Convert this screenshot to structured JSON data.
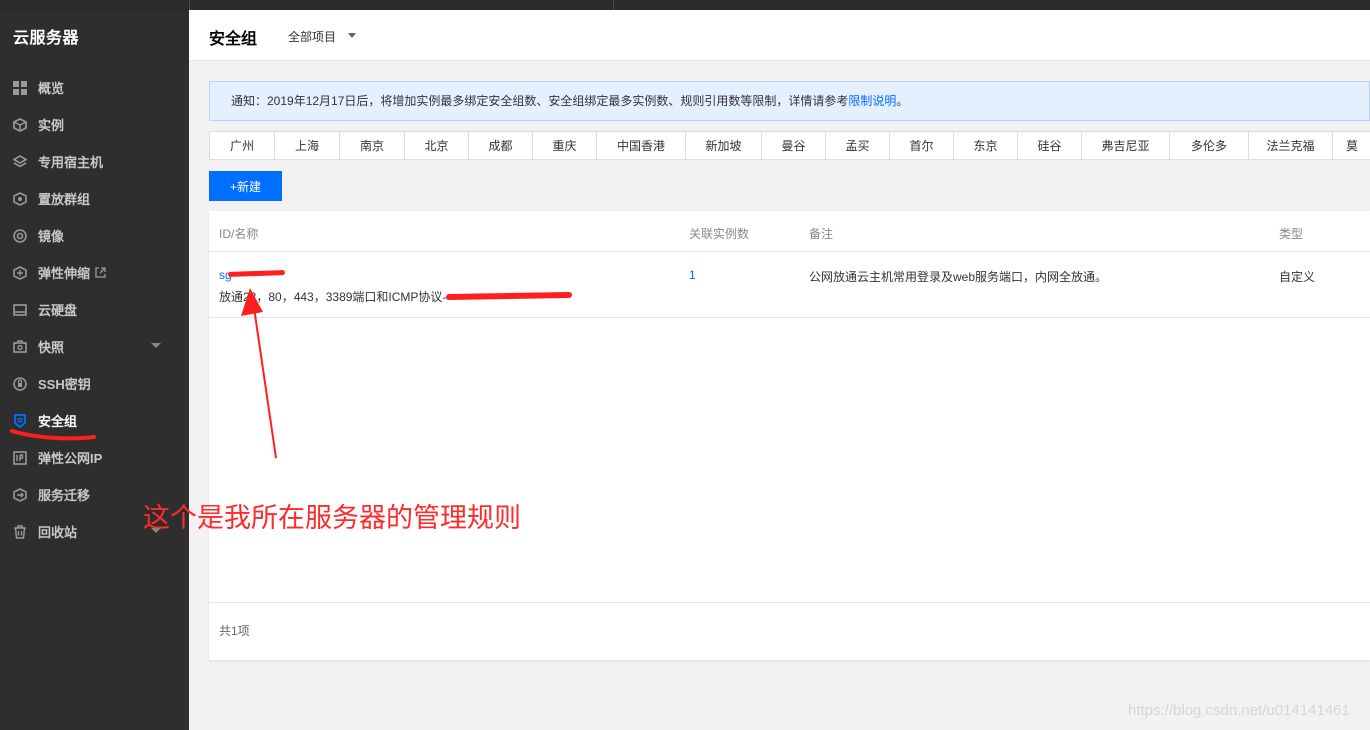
{
  "sidebar": {
    "title": "云服务器",
    "items": [
      {
        "label": "概览"
      },
      {
        "label": "实例"
      },
      {
        "label": "专用宿主机"
      },
      {
        "label": "置放群组"
      },
      {
        "label": "镜像"
      },
      {
        "label": "弹性伸缩"
      },
      {
        "label": "云硬盘"
      },
      {
        "label": "快照"
      },
      {
        "label": "SSH密钥"
      },
      {
        "label": "安全组"
      },
      {
        "label": "弹性公网IP"
      },
      {
        "label": "服务迁移"
      },
      {
        "label": "回收站"
      }
    ]
  },
  "header": {
    "title": "安全组",
    "project": "全部项目"
  },
  "notice": {
    "text": "通知：2019年12月17日后，将增加实例最多绑定安全组数、安全组绑定最多实例数、规则引用数等限制，详情请参考",
    "link": "限制说明",
    "end": "。"
  },
  "regions": [
    "广州",
    "上海",
    "南京",
    "北京",
    "成都",
    "重庆",
    "中国香港",
    "新加坡",
    "曼谷",
    "孟买",
    "首尔",
    "东京",
    "硅谷",
    "弗吉尼亚",
    "多伦多",
    "法兰克福",
    "莫"
  ],
  "toolbar": {
    "new_label": "+新建"
  },
  "table": {
    "headers": {
      "id": "ID/名称",
      "count": "关联实例数",
      "note": "备注",
      "type": "类型"
    },
    "rows": [
      {
        "id": "sg-",
        "name": "放通22，80，443，3389端口和ICMP协议-",
        "count": "1",
        "note": "公网放通云主机常用登录及web服务端口，内网全放通。",
        "type": "自定义"
      }
    ],
    "footer": "共1项"
  },
  "annotation": {
    "text": "这个是我所在服务器的管理规则",
    "color": "#ff2a2a"
  },
  "watermark": "https://blog.csdn.net/u014141461",
  "colors": {
    "accent": "#006eff",
    "sidebar": "#2e2e2e",
    "notice_bg": "#e5f0fe"
  }
}
